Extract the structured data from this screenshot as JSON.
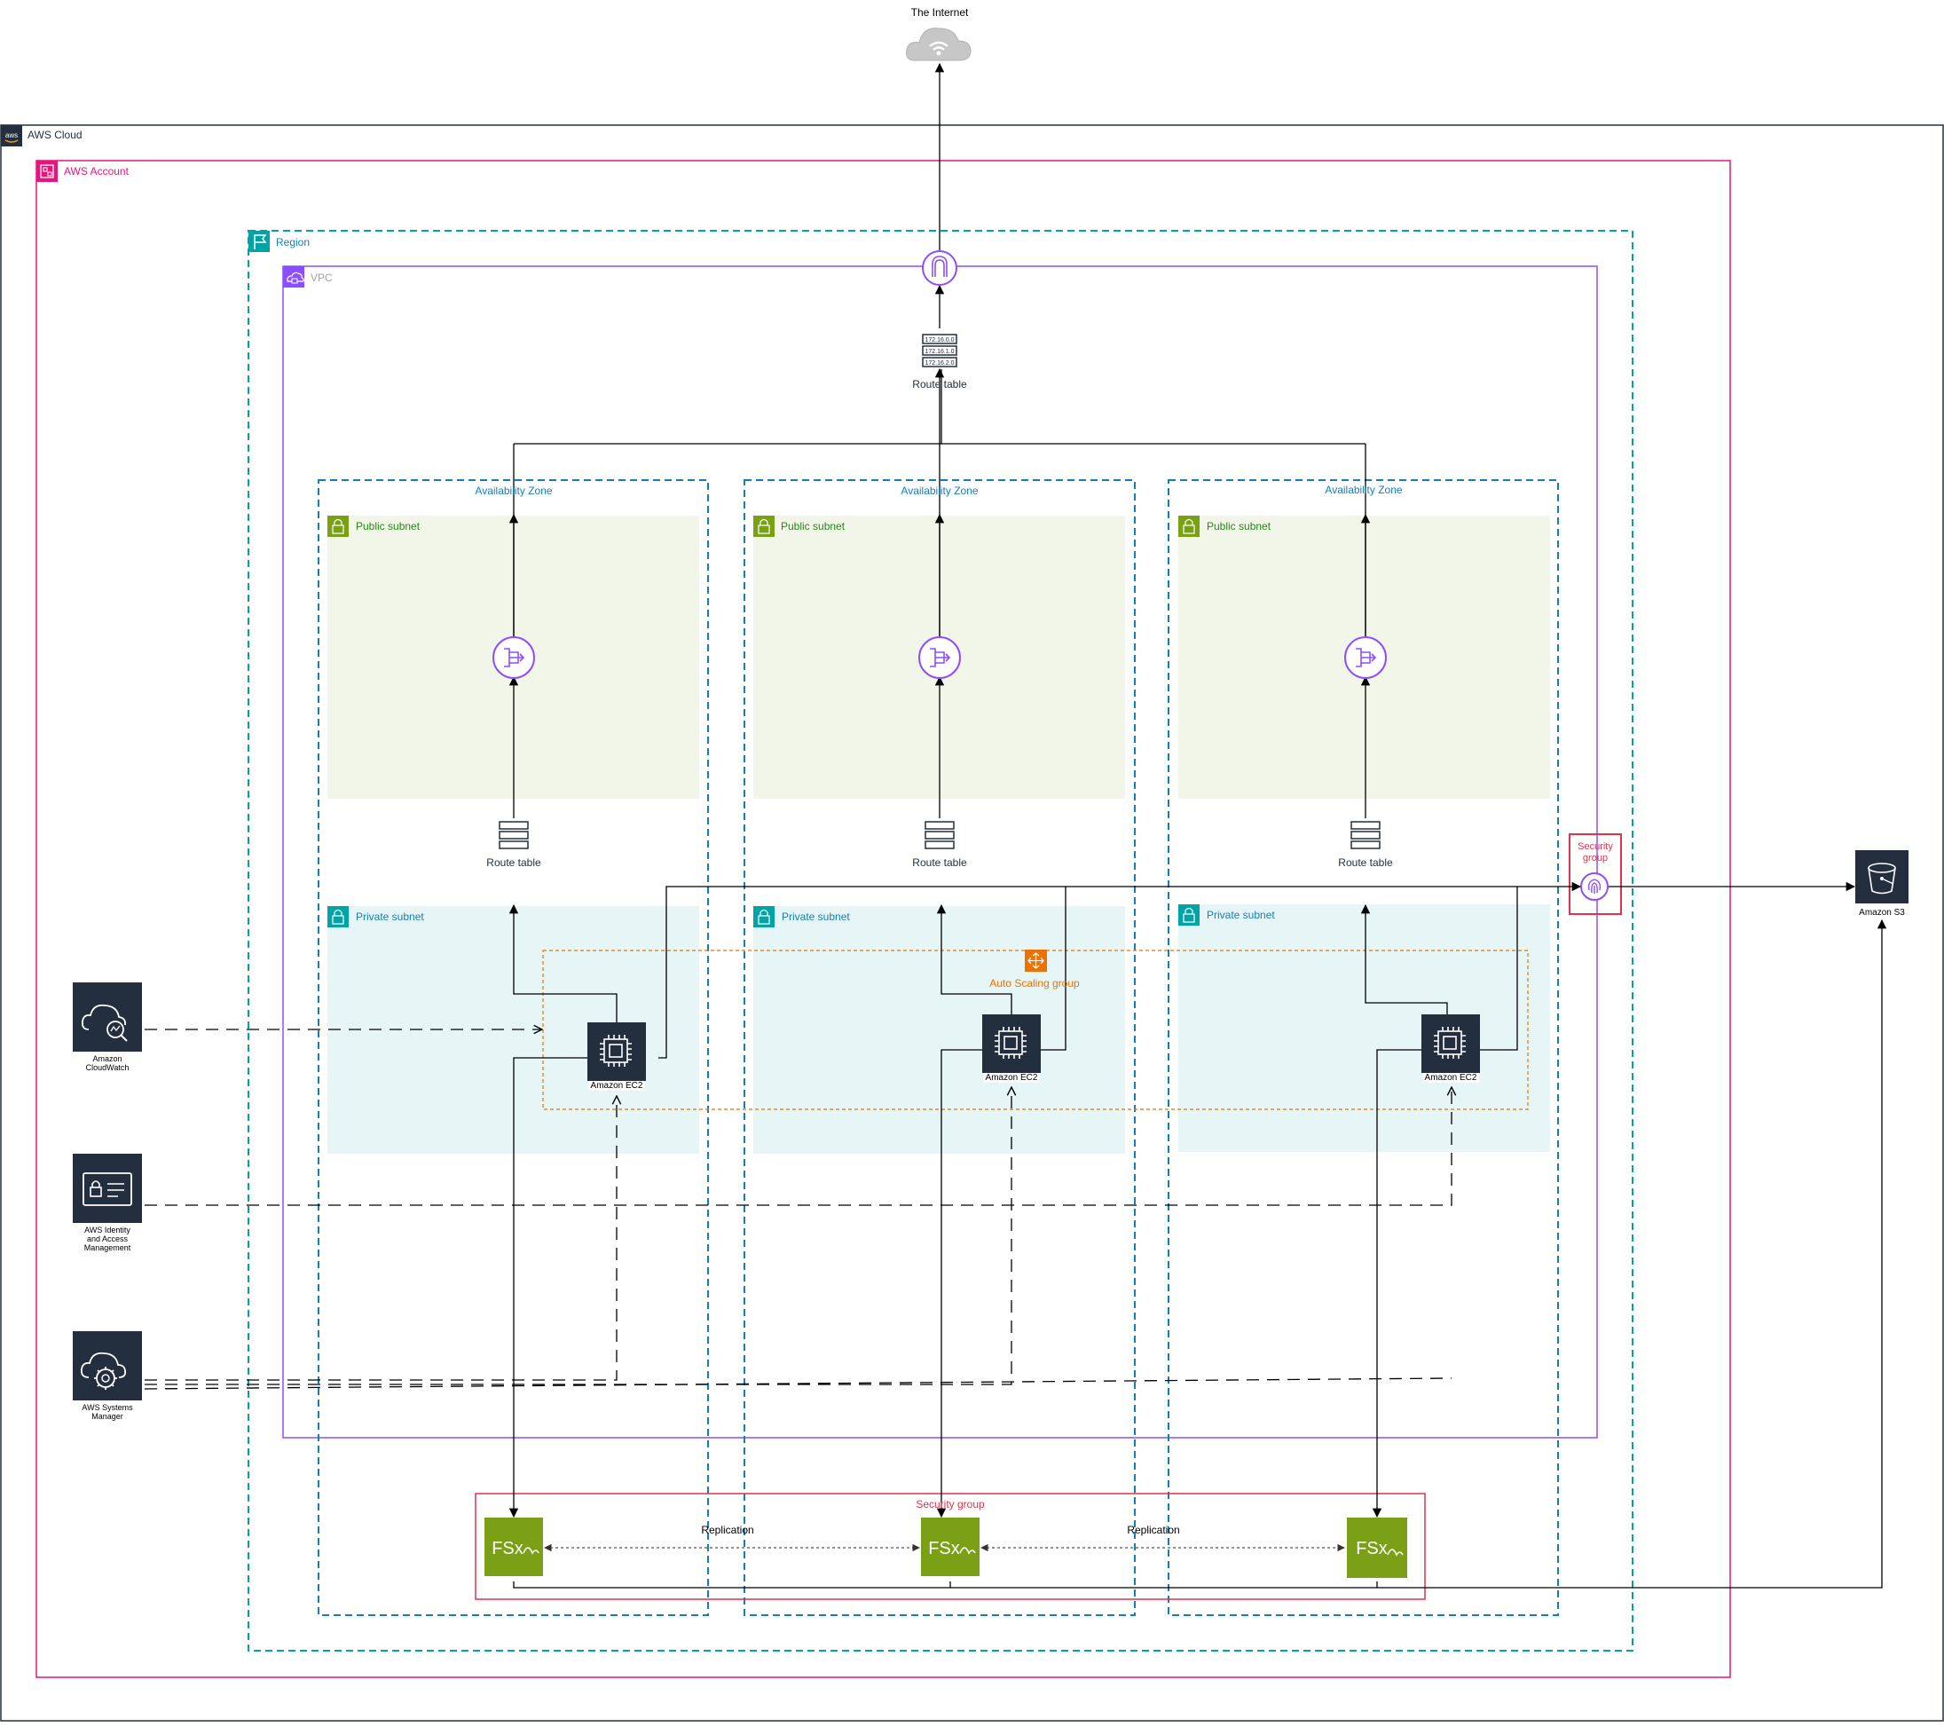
{
  "internet": {
    "label": "The Internet"
  },
  "aws_cloud": {
    "label": "AWS Cloud",
    "icon": "aws-logo-icon"
  },
  "aws_account": {
    "label": "AWS Account",
    "color": "#E7157B"
  },
  "region": {
    "label": "Region",
    "color": "#00A4A6"
  },
  "vpc": {
    "label": "VPC",
    "color": "#8C4FFF"
  },
  "internet_gateway": {
    "icon": "internet-gateway-icon"
  },
  "route_table_main": {
    "label": "Route table",
    "entries": [
      "172.16.0.0",
      "172.16.1.0",
      "172.16.2.0"
    ]
  },
  "availability_zones": [
    {
      "label": "Availability Zone",
      "public_subnet": {
        "label": "Public subnet"
      },
      "route_table": {
        "label": "Route table"
      },
      "private_subnet": {
        "label": "Private subnet"
      },
      "ec2": {
        "label": "Amazon EC2"
      },
      "fsx": {
        "label": "FSx"
      }
    },
    {
      "label": "Availability Zone",
      "public_subnet": {
        "label": "Public subnet"
      },
      "route_table": {
        "label": "Route table"
      },
      "private_subnet": {
        "label": "Private subnet"
      },
      "ec2": {
        "label": "Amazon EC2"
      },
      "fsx": {
        "label": "FSx"
      }
    },
    {
      "label": "Availability Zone",
      "public_subnet": {
        "label": "Public subnet"
      },
      "route_table": {
        "label": "Route table"
      },
      "private_subnet": {
        "label": "Private subnet"
      },
      "ec2": {
        "label": "Amazon EC2"
      },
      "fsx": {
        "label": "FSx"
      }
    }
  ],
  "auto_scaling_group": {
    "label": "Auto Scaling group",
    "color": "#ED7100"
  },
  "security_group_s3": {
    "label_line1": "Security",
    "label_line2": "group",
    "color": "#DD344C"
  },
  "security_group_fsx": {
    "label": "Security group"
  },
  "replication_labels": [
    "Replication",
    "Replication"
  ],
  "s3": {
    "label": "Amazon S3"
  },
  "services": [
    {
      "line1": "Amazon",
      "line2": "CloudWatch",
      "line3": "",
      "icon": "cloudwatch-icon"
    },
    {
      "line1": "AWS Identity",
      "line2": "and Access",
      "line3": "Management",
      "icon": "iam-icon"
    },
    {
      "line1": "AWS Systems",
      "line2": "Manager",
      "line3": "",
      "icon": "systems-manager-icon"
    }
  ],
  "colors": {
    "public_subnet_fill": "#F2F6E8",
    "public_subnet_text": "#248814",
    "private_subnet_fill": "#E6F6F7",
    "private_subnet_text": "#147EBA",
    "az_border": "#147EBA",
    "fsx_fill": "#7AA116",
    "service_fill": "#232F3E"
  }
}
